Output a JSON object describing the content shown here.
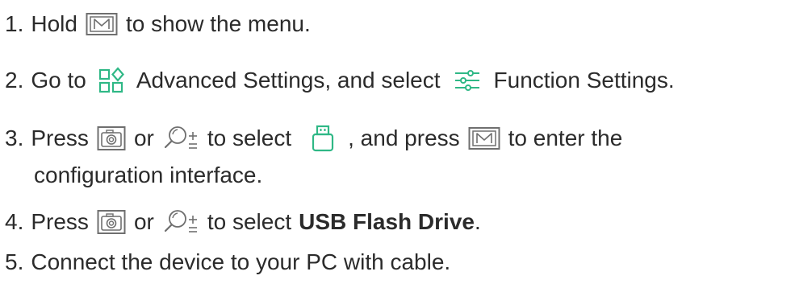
{
  "steps": [
    {
      "num": "1.",
      "text_a": "Hold",
      "icon_1": "menu-button-icon",
      "text_b": "to show the menu."
    },
    {
      "num": "2.",
      "text_a": "Go to",
      "icon_1": "advanced-settings-icon",
      "text_b": "Advanced Settings, and select",
      "icon_2": "function-settings-icon",
      "text_c": "Function Settings."
    },
    {
      "num": "3.",
      "text_a": "Press",
      "icon_1": "camera-button-icon",
      "text_b": "or",
      "icon_2": "zoom-button-icon",
      "text_c": "to select",
      "icon_3": "usb-icon",
      "text_d": ", and press",
      "icon_4": "menu-button-icon",
      "text_e": "to enter the",
      "text_f": "configuration interface."
    },
    {
      "num": "4.",
      "text_a": "Press",
      "icon_1": "camera-button-icon",
      "text_b": "or",
      "icon_2": "zoom-button-icon",
      "text_c": "to select",
      "text_bold": "USB Flash Drive",
      "text_d": "."
    },
    {
      "num": "5.",
      "text_a": "Connect the device to your PC with cable."
    }
  ],
  "colors": {
    "text": "#2b2b2b",
    "icon_green": "#2fb886",
    "icon_gray": "#6f6f6f"
  }
}
